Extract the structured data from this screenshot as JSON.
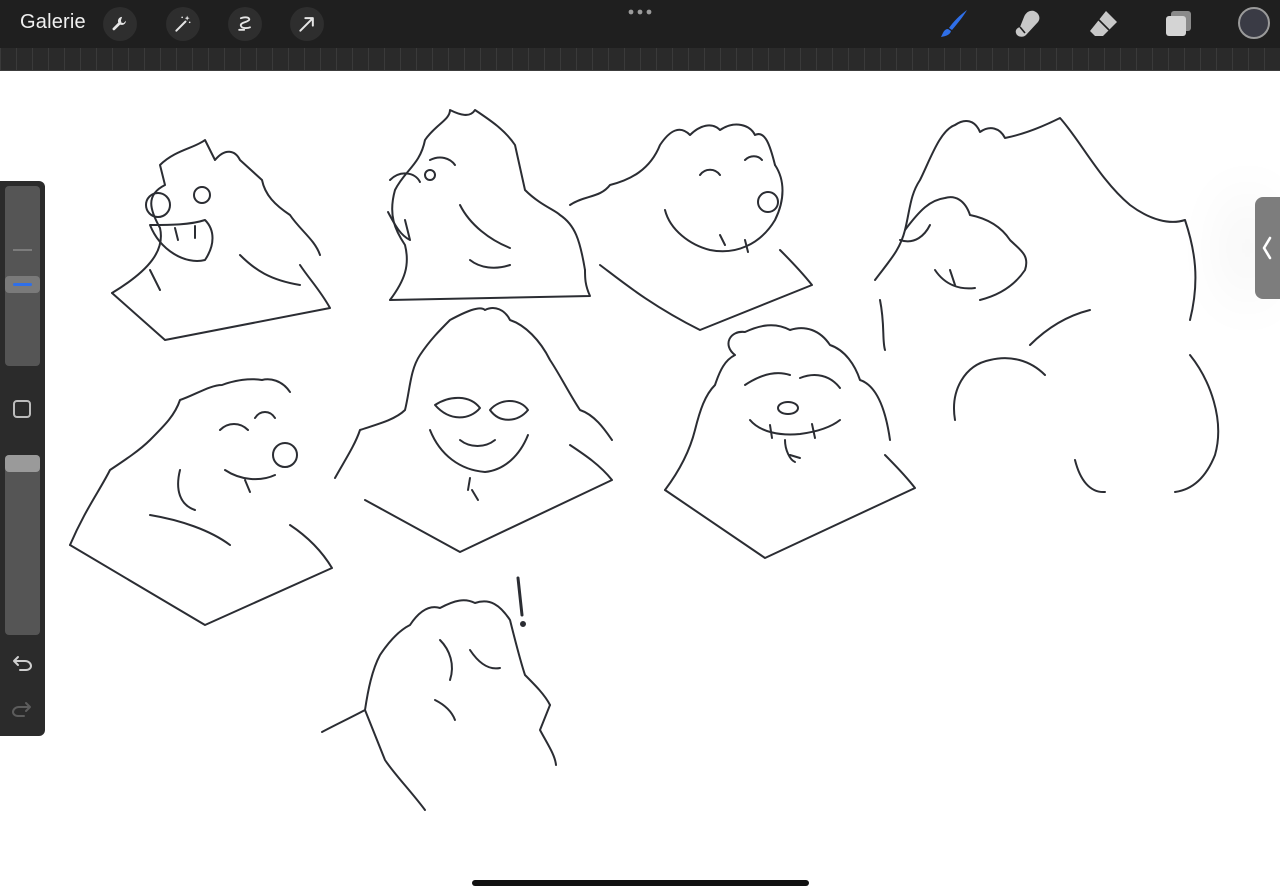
{
  "toolbar": {
    "gallery_label": "Galerie",
    "left_tools": [
      "wrench-icon",
      "magic-wand-icon",
      "selection-icon",
      "transform-arrow-icon"
    ],
    "right_tools": [
      "brush-icon",
      "smudge-icon",
      "eraser-icon",
      "layers-icon"
    ],
    "active_tool": "brush-icon",
    "active_color": "#3a3b45",
    "accent_color": "#2f6fe8"
  },
  "sidebar": {
    "brush_size_fraction": 0.45,
    "opacity_fraction": 0.0
  },
  "canvas": {
    "background": "#ffffff",
    "stroke_color": "#2b2d33",
    "sketch_annotation": "!"
  }
}
